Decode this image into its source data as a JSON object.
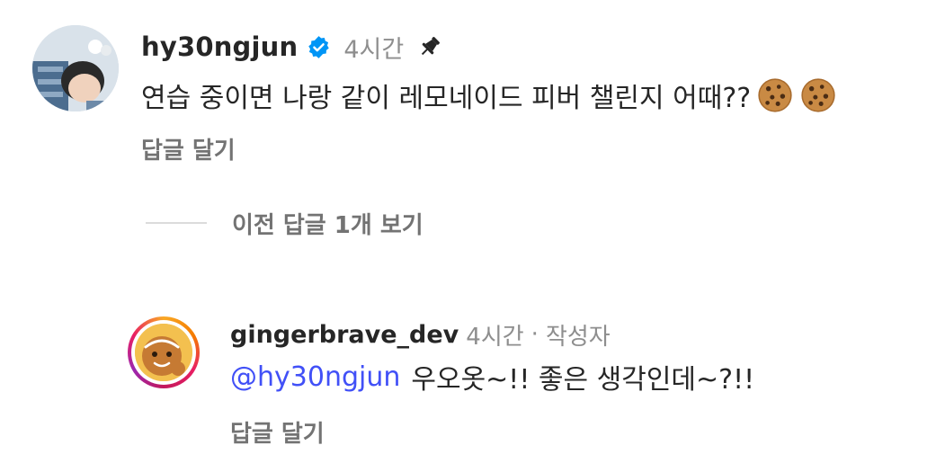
{
  "main_comment": {
    "username": "hy30ngjun",
    "time": "4시간",
    "text": "연습 중이면 나랑 같이 레모네이드 피버 챌린지 어때??",
    "reply_label": "답글 달기",
    "emoji": [
      "cookie-icon",
      "cookie-icon"
    ]
  },
  "view_previous": {
    "label": "이전 답글 1개 보기"
  },
  "reply_comment": {
    "username": "gingerbrave_dev",
    "time": "4시간",
    "separator": "·",
    "author_label": "작성자",
    "mention": "@hy30ngjun",
    "text": "우오옷~!! 좋은 생각인데~?!!",
    "reply_label": "답글 달기"
  },
  "colors": {
    "mention": "#4150f7",
    "verified": "#0095f6",
    "secondary_text": "#737373"
  }
}
